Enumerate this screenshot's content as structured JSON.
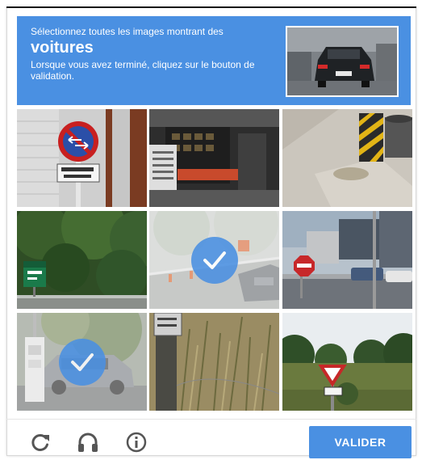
{
  "header": {
    "instruction_prefix": "Sélectionnez toutes les images montrant des",
    "target_object": "voitures",
    "instruction_suffix": "Lorsque vous avez terminé, cliquez sur le bouton de validation."
  },
  "tiles": [
    {
      "id": 1,
      "subject": "parking-sign",
      "selected": false
    },
    {
      "id": 2,
      "subject": "shop-front",
      "selected": false
    },
    {
      "id": 3,
      "subject": "curb-barrier",
      "selected": false
    },
    {
      "id": 4,
      "subject": "trees-highway-sign",
      "selected": false
    },
    {
      "id": 5,
      "subject": "road-car",
      "selected": true
    },
    {
      "id": 6,
      "subject": "street-stop-sign",
      "selected": false
    },
    {
      "id": 7,
      "subject": "street-car",
      "selected": true
    },
    {
      "id": 8,
      "subject": "grass-post",
      "selected": false
    },
    {
      "id": 9,
      "subject": "yield-sign-trees",
      "selected": false
    }
  ],
  "footer": {
    "reload_icon": "reload-icon",
    "audio_icon": "headphones-icon",
    "info_icon": "info-icon",
    "verify_label": "VALIDER"
  },
  "colors": {
    "accent": "#4a90e2",
    "header_text": "#ffffff",
    "icon": "#555555"
  }
}
